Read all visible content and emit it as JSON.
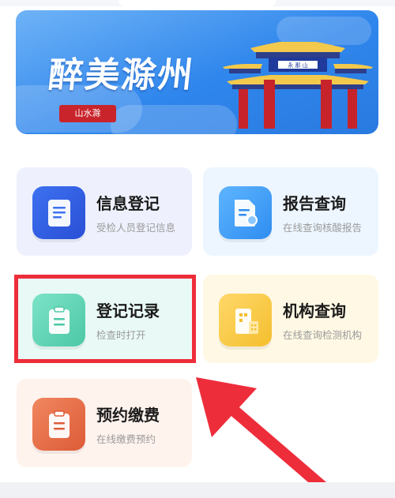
{
  "banner": {
    "title": "醉美滁州",
    "seal_text": "山水滁",
    "gate_plaque": "永 那 山",
    "colors": {
      "sky": "#2f86ec",
      "pillar": "#c7232b",
      "roof": "#f2c94c",
      "seal": "#c9242b"
    }
  },
  "services": [
    {
      "title": "信息登记",
      "subtitle": "受检人员登记信息",
      "icon": "document-icon"
    },
    {
      "title": "报告查询",
      "subtitle": "在线查询核酸报告",
      "icon": "report-search-icon"
    },
    {
      "title": "登记记录",
      "subtitle": "检查时打开",
      "icon": "clipboard-icon",
      "highlighted": true
    },
    {
      "title": "机构查询",
      "subtitle": "在线查询检测机构",
      "icon": "building-icon"
    },
    {
      "title": "预约缴费",
      "subtitle": "在线缴费预约",
      "icon": "clipboard-icon"
    }
  ],
  "annotation": {
    "color": "#ee2d3b"
  }
}
